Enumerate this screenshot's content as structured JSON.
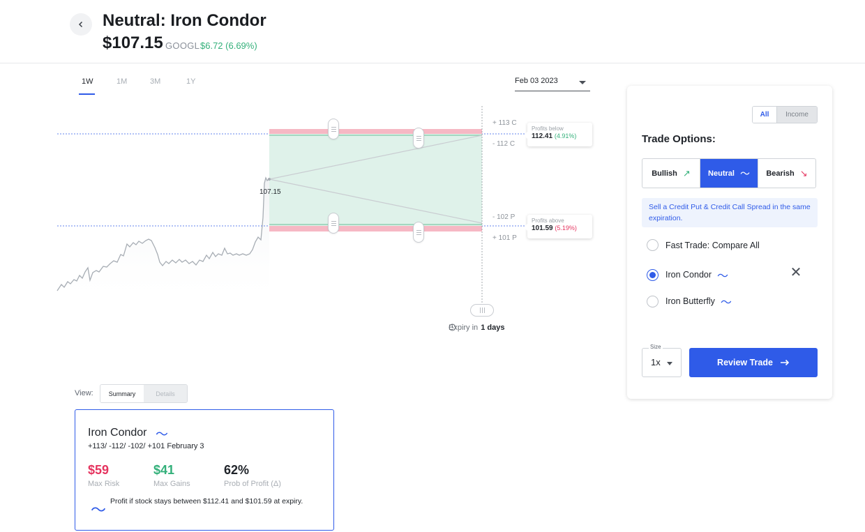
{
  "header": {
    "title": "Neutral: Iron Condor",
    "price": "$107.15",
    "ticker": "GOOGL",
    "change": "$6.72 (6.69%)"
  },
  "time_tabs": [
    "1W",
    "1M",
    "3M",
    "1Y"
  ],
  "active_tab": "1W",
  "date_select": {
    "value": "Feb 03 2023"
  },
  "chart": {
    "current_price_label": "107.15",
    "strikes": {
      "s113c": "+ 113 C",
      "s112c": "- 112 C",
      "s102p": "- 102 P",
      "s101p": "+ 101 P"
    },
    "profits_below": {
      "label": "Profits below",
      "value": "112.41",
      "pct": "(4.91%)"
    },
    "profits_above": {
      "label": "Profits above",
      "value": "101.59",
      "pct": "(5.19%)"
    },
    "expiry": {
      "prefix": "Expiry in",
      "value": "1 days"
    }
  },
  "view": {
    "label": "View:",
    "options": [
      "Summary",
      "Details"
    ]
  },
  "summary": {
    "title": "Iron Condor",
    "wave_symbol": "〜",
    "legs": "+113/ -112/ -102/ +101 February 3",
    "max_risk": {
      "value": "$59",
      "label": "Max Risk"
    },
    "max_gains": {
      "value": "$41",
      "label": "Max Gains"
    },
    "prob_profit": {
      "value": "62%",
      "label": "Prob of Profit (Δ)"
    },
    "note": "Profit if stock stays between $112.41 and $101.59 at expiry."
  },
  "panel": {
    "filter": [
      "All",
      "Income"
    ],
    "title": "Trade Options:",
    "directions": [
      "Bullish",
      "Neutral",
      "Bearish"
    ],
    "info": "Sell a Credit Put & Credit Call Spread in the same expiration.",
    "options": [
      "Fast Trade: Compare All",
      "Iron Condor",
      "Iron Butterfly"
    ],
    "selected_option": "Iron Condor",
    "size_label": "Size",
    "size_value": "1x",
    "review_button": "Review Trade"
  },
  "colors": {
    "accent": "#2f5be8",
    "gain": "#33b07a",
    "loss": "#e5345f",
    "profit_zone": "#dff2ea",
    "loss_band": "#f6b8c4"
  }
}
